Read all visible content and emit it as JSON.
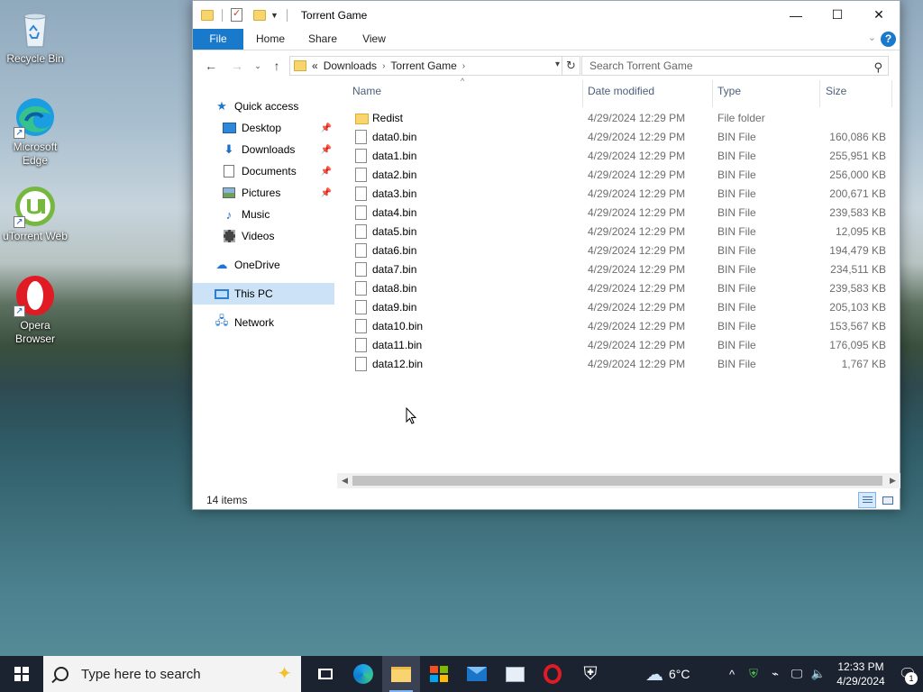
{
  "desktop": {
    "icons": [
      {
        "label": "Recycle Bin"
      },
      {
        "label": "Microsoft Edge"
      },
      {
        "label": "uTorrent Web"
      },
      {
        "label": "Opera Browser"
      }
    ]
  },
  "window": {
    "title": "Torrent Game",
    "controls": {
      "minimize": "—",
      "maximize": "☐",
      "close": "✕"
    },
    "ribbon": {
      "tabs": [
        "File",
        "Home",
        "Share",
        "View"
      ],
      "help": "?"
    },
    "address": {
      "overflow": "«",
      "crumbs": [
        "Downloads",
        "Torrent Game"
      ],
      "search_placeholder": "Search Torrent Game"
    },
    "nav": {
      "items": [
        {
          "label": "Quick access",
          "icon": "star-icon"
        },
        {
          "label": "Desktop",
          "icon": "desktop-folder-icon",
          "pinned": true
        },
        {
          "label": "Downloads",
          "icon": "downloads-icon",
          "pinned": true
        },
        {
          "label": "Documents",
          "icon": "documents-icon",
          "pinned": true
        },
        {
          "label": "Pictures",
          "icon": "pictures-icon",
          "pinned": true
        },
        {
          "label": "Music",
          "icon": "music-icon"
        },
        {
          "label": "Videos",
          "icon": "videos-icon"
        },
        {
          "label": "OneDrive",
          "icon": "onedrive-icon"
        },
        {
          "label": "This PC",
          "icon": "this-pc-icon",
          "selected": true
        },
        {
          "label": "Network",
          "icon": "network-icon"
        }
      ]
    },
    "columns": {
      "name": "Name",
      "date": "Date modified",
      "type": "Type",
      "size": "Size"
    },
    "files": [
      {
        "name": "Redist",
        "date": "4/29/2024 12:29 PM",
        "type": "File folder",
        "size": ""
      },
      {
        "name": "data0.bin",
        "date": "4/29/2024 12:29 PM",
        "type": "BIN File",
        "size": "160,086 KB"
      },
      {
        "name": "data1.bin",
        "date": "4/29/2024 12:29 PM",
        "type": "BIN File",
        "size": "255,951 KB"
      },
      {
        "name": "data2.bin",
        "date": "4/29/2024 12:29 PM",
        "type": "BIN File",
        "size": "256,000 KB"
      },
      {
        "name": "data3.bin",
        "date": "4/29/2024 12:29 PM",
        "type": "BIN File",
        "size": "200,671 KB"
      },
      {
        "name": "data4.bin",
        "date": "4/29/2024 12:29 PM",
        "type": "BIN File",
        "size": "239,583 KB"
      },
      {
        "name": "data5.bin",
        "date": "4/29/2024 12:29 PM",
        "type": "BIN File",
        "size": "12,095 KB"
      },
      {
        "name": "data6.bin",
        "date": "4/29/2024 12:29 PM",
        "type": "BIN File",
        "size": "194,479 KB"
      },
      {
        "name": "data7.bin",
        "date": "4/29/2024 12:29 PM",
        "type": "BIN File",
        "size": "234,511 KB"
      },
      {
        "name": "data8.bin",
        "date": "4/29/2024 12:29 PM",
        "type": "BIN File",
        "size": "239,583 KB"
      },
      {
        "name": "data9.bin",
        "date": "4/29/2024 12:29 PM",
        "type": "BIN File",
        "size": "205,103 KB"
      },
      {
        "name": "data10.bin",
        "date": "4/29/2024 12:29 PM",
        "type": "BIN File",
        "size": "153,567 KB"
      },
      {
        "name": "data11.bin",
        "date": "4/29/2024 12:29 PM",
        "type": "BIN File",
        "size": "176,095 KB"
      },
      {
        "name": "data12.bin",
        "date": "4/29/2024 12:29 PM",
        "type": "BIN File",
        "size": "1,767 KB"
      }
    ],
    "status": {
      "item_count": "14 items"
    }
  },
  "taskbar": {
    "search_placeholder": "Type here to search",
    "weather": {
      "temp": "6°C"
    },
    "clock": {
      "time": "12:33 PM",
      "date": "4/29/2024"
    },
    "notification_count": "1"
  },
  "colors": {
    "accent": "#1979ca",
    "selection": "#cce3f7",
    "taskbar": "#1c2330"
  }
}
